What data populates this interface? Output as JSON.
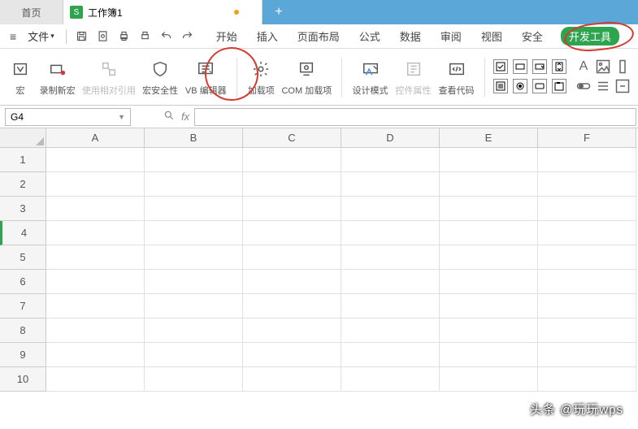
{
  "title_bar": {
    "home_label": "首页",
    "doc_label": "工作簿1",
    "doc_icon_letter": "S",
    "new_tab_label": "+"
  },
  "menu_bar": {
    "file_label": "文件",
    "tabs": [
      "开始",
      "插入",
      "页面布局",
      "公式",
      "数据",
      "审阅",
      "视图",
      "安全",
      "开发工具"
    ],
    "active_index": 8
  },
  "ribbon": {
    "macro": "宏",
    "record_macro": "录制新宏",
    "relative_ref": "使用相对引用",
    "macro_security": "宏安全性",
    "vb_editor": "VB 编辑器",
    "addins": "加载项",
    "com_addins": "COM 加载项",
    "design_mode": "设计模式",
    "control_props": "控件属性",
    "view_code": "查看代码"
  },
  "fx_bar": {
    "name_box_value": "G4",
    "fx_label": "fx"
  },
  "grid": {
    "columns": [
      "A",
      "B",
      "C",
      "D",
      "E",
      "F"
    ],
    "rows": [
      "1",
      "2",
      "3",
      "4",
      "5",
      "6",
      "7",
      "8",
      "9",
      "10"
    ],
    "selected_row_index": 3
  },
  "watermark": "头条 @玩玩wps"
}
